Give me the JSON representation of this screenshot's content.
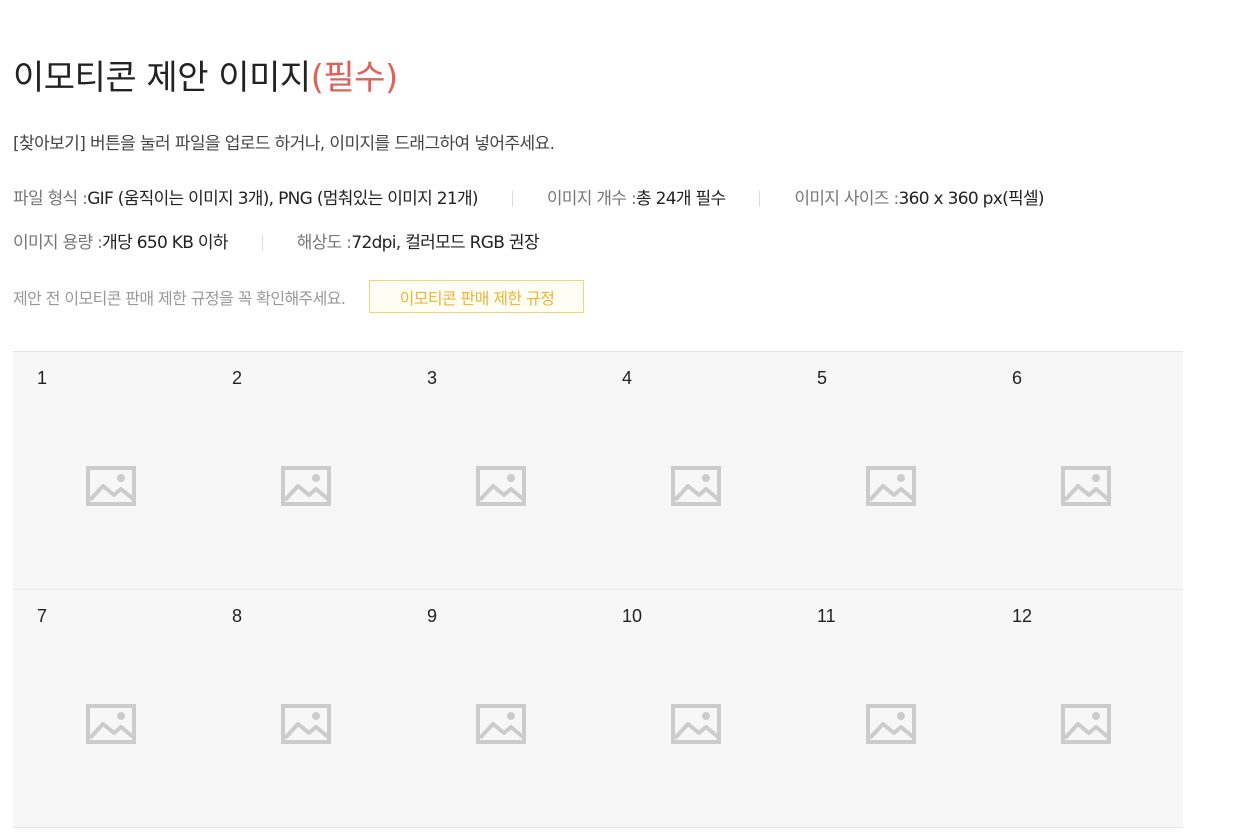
{
  "heading": {
    "title": "이모티콘 제안 이미지",
    "required": "(필수)"
  },
  "description": "[찾아보기] 버튼을 눌러 파일을 업로드 하거나, 이미지를 드래그하여 넣어주세요.",
  "specs": {
    "row1": [
      {
        "key": "파일 형식 : ",
        "value": "GIF (움직이는 이미지 3개), PNG (멈춰있는 이미지 21개)"
      },
      {
        "key": "이미지 개수 : ",
        "value": "총 24개 필수"
      },
      {
        "key": "이미지 사이즈 : ",
        "value": "360 x 360 px(픽셀)"
      }
    ],
    "row2": [
      {
        "key": "이미지 용량 : ",
        "value": "개당 650 KB 이하"
      },
      {
        "key": "해상도 : ",
        "value": "72dpi, 컬러모드 RGB 권장"
      }
    ]
  },
  "notice": {
    "text": "제안 전 이모티콘 판매 제한 규정을 꼭 확인해주세요.",
    "button_label": "이모티콘 판매 제한 규정"
  },
  "slots": [
    {
      "num": "1",
      "icon": "image-placeholder-icon"
    },
    {
      "num": "2",
      "icon": "image-placeholder-icon"
    },
    {
      "num": "3",
      "icon": "image-placeholder-icon"
    },
    {
      "num": "4",
      "icon": "image-placeholder-icon"
    },
    {
      "num": "5",
      "icon": "image-placeholder-icon"
    },
    {
      "num": "6",
      "icon": "image-placeholder-icon"
    },
    {
      "num": "7",
      "icon": "image-placeholder-icon"
    },
    {
      "num": "8",
      "icon": "image-placeholder-icon"
    },
    {
      "num": "9",
      "icon": "image-placeholder-icon"
    },
    {
      "num": "10",
      "icon": "image-placeholder-icon"
    },
    {
      "num": "11",
      "icon": "image-placeholder-icon"
    },
    {
      "num": "12",
      "icon": "image-placeholder-icon"
    }
  ],
  "colors": {
    "required_accent": "#e0605a",
    "button_border": "#f5d27a",
    "button_text": "#f0b43c",
    "slot_background": "#f7f7f7",
    "icon_gray": "#cccccc"
  }
}
